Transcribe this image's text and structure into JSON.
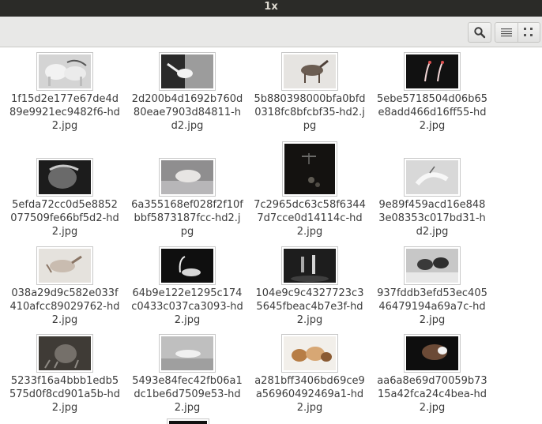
{
  "window": {
    "title": "1x"
  },
  "toolbar": {
    "search_icon": "search-icon",
    "list_icon": "list-view-icon",
    "grid_icon": "grid-view-icon"
  },
  "files": [
    {
      "name": "1f15d2e177e67de4d89e9921ec9482f6-hd2.jpg"
    },
    {
      "name": "2d200b4d1692b760d80eae7903d84811-hd2.jpg"
    },
    {
      "name": "5b880398000bfa0bfd0318fc8bfcbf35-hd2.jpg"
    },
    {
      "name": "5ebe5718504d06b65e8add466d16ff55-hd2.jpg"
    },
    {
      "name": "5efda72cc0d5e8852077509fe66bf5d2-hd2.jpg"
    },
    {
      "name": "6a355168ef028f2f10fbbf5873187fcc-hd2.jpg"
    },
    {
      "name": "7c2965dc63c58f63447d7cce0d14114c-hd2.jpg"
    },
    {
      "name": "9e89f459acd16e8483e08353c017bd31-hd2.jpg"
    },
    {
      "name": "038a29d9c582e033f410afcc89029762-hd2.jpg"
    },
    {
      "name": "64b9e122e1295c174c0433c037ca3093-hd2.jpg"
    },
    {
      "name": "104e9c9c4327723c35645fbeac4b7e3f-hd2.jpg"
    },
    {
      "name": "937fddb3efd53ec40546479194a69a7c-hd2.jpg"
    },
    {
      "name": "5233f16a4bbb1edb5575d0f8cd901a5b-hd2.jpg"
    },
    {
      "name": "5493e84fec42fb06a1dc1be6d7509e53-hd2.jpg"
    },
    {
      "name": "a281bff3406bd69ce9a56960492469a1-hd2.jpg"
    },
    {
      "name": "aa6a8e69d70059b7315a42fca24c4bea-hd2.jpg"
    }
  ]
}
